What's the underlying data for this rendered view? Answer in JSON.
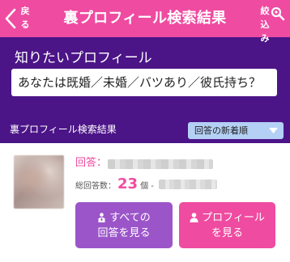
{
  "header": {
    "back_label": "戻る",
    "title": "裏プロフィール検索結果",
    "filter_label": "絞込み",
    "color": "#ef4ba1"
  },
  "query": {
    "label": "知りたいプロフィール",
    "value": "あなたは既婚／未婚／バツあり／彼氏持ち？"
  },
  "results": {
    "label": "裏プロフィール検索結果",
    "sort_selected": "回答の新着順"
  },
  "card": {
    "answer_label": "回答：",
    "count_label": "総回答数：",
    "count_value": "23",
    "count_unit": "個 -",
    "button_all_line1": "すべての",
    "button_all_line2": "回答を見る",
    "button_profile_line1": "プロフィール",
    "button_profile_line2": "を見る"
  },
  "icons": {
    "back": "chevron-left-icon",
    "filter": "search-icon",
    "sort": "chevron-down-icon",
    "all_answers": "group-icon",
    "profile": "person-icon"
  }
}
